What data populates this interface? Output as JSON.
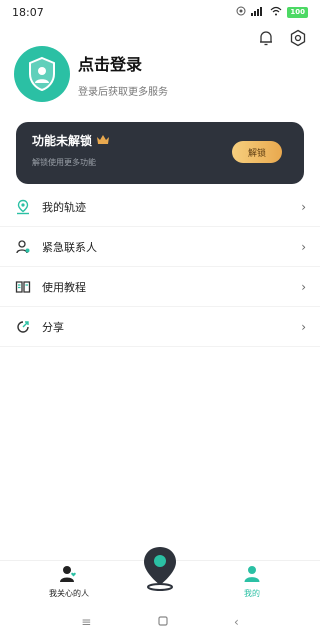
{
  "status": {
    "time": "18:07",
    "battery": "100"
  },
  "profile": {
    "title": "点击登录",
    "subtitle": "登录后获取更多服务"
  },
  "unlock": {
    "title": "功能未解锁",
    "subtitle": "解锁使用更多功能",
    "button": "解锁"
  },
  "menu": [
    {
      "label": "我的轨迹",
      "icon": "location-pin-icon"
    },
    {
      "label": "紧急联系人",
      "icon": "emergency-contact-icon"
    },
    {
      "label": "使用教程",
      "icon": "book-icon"
    },
    {
      "label": "分享",
      "icon": "share-icon"
    }
  ],
  "nav": {
    "left_label": "我关心的人",
    "right_label": "我的"
  },
  "colors": {
    "accent": "#2bc0a4",
    "card_bg": "#2e333c",
    "gold": "#e9a94f"
  }
}
